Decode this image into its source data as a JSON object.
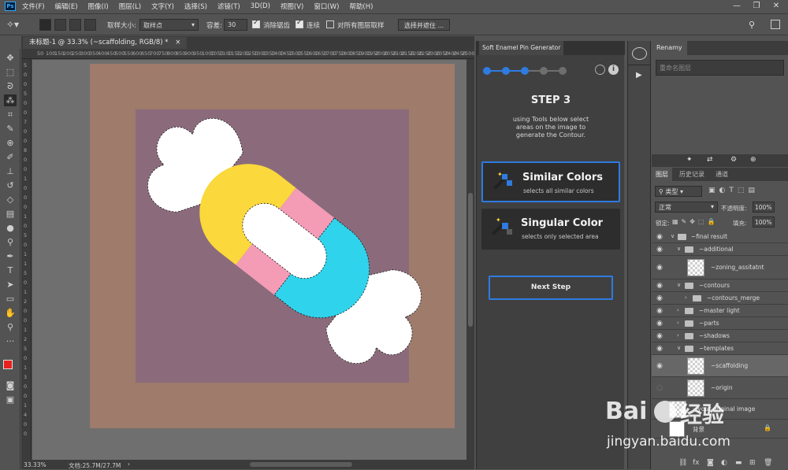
{
  "menubar": {
    "app_icon": "Ps",
    "items": [
      "文件(F)",
      "编辑(E)",
      "图像(I)",
      "图层(L)",
      "文字(Y)",
      "选择(S)",
      "滤镜(T)",
      "3D(D)",
      "视图(V)",
      "窗口(W)",
      "帮助(H)"
    ]
  },
  "options_bar": {
    "sample_size_label": "取样大小:",
    "sample_size_value": "取样点",
    "tolerance_label": "容差:",
    "tolerance_value": "30",
    "antialias_label": "消除锯齿",
    "contiguous_label": "连续",
    "sample_all_label": "对所有图层取样",
    "select_mask_label": "选择并遮住 ..."
  },
  "document": {
    "tab_title": "未标题-1 @ 33.3% (~scaffolding, RGB/8) *",
    "ruler_top": [
      "50",
      "100",
      "150",
      "200",
      "250",
      "300",
      "350",
      "400",
      "450",
      "500",
      "550",
      "600",
      "650",
      "700",
      "750",
      "800",
      "850",
      "900",
      "950",
      "1000",
      "1050",
      "1100",
      "1150",
      "1200",
      "1250",
      "1300",
      "1350",
      "1400",
      "1450",
      "1500",
      "1550",
      "1600",
      "1650",
      "1700",
      "1750",
      "1800",
      "1850",
      "1900",
      "1950",
      "2000",
      "2050",
      "2100",
      "2150",
      "2200",
      "2250",
      "2300",
      "2350",
      "2400",
      "2450",
      "2500"
    ],
    "ruler_left": [
      "5",
      "0",
      "0",
      "5",
      "0",
      "0",
      "7",
      "0",
      "0",
      "8",
      "0",
      "0",
      "1",
      "0",
      "0",
      "0",
      "1",
      "0",
      "5",
      "0",
      "1",
      "1",
      "5",
      "0",
      "1",
      "2",
      "0",
      "0",
      "1",
      "2",
      "5",
      "0",
      "1",
      "3",
      "0",
      "0",
      "1",
      "4",
      "0",
      "0"
    ],
    "zoom": "33.33%",
    "doc_info": "文档:25.7M/27.7M"
  },
  "plugin": {
    "tab_title": "Soft Enamel Pin Generator",
    "step_title": "STEP 3",
    "step_desc_lines": [
      "using Tools below select",
      "areas on the image to",
      "generate the Contour."
    ],
    "options": [
      {
        "title": "Similar Colors",
        "subtitle": "selects all similar colors"
      },
      {
        "title": "Singular Color",
        "subtitle": "selects only selected area"
      }
    ],
    "next_label": "Next Step",
    "colors": {
      "accent": "#2f7be0",
      "dot_active": "#2f7be0",
      "dot_inactive": "#6e6e6e"
    }
  },
  "renamy": {
    "tab_title": "Renamy",
    "search_placeholder": "重命名图层"
  },
  "layers_panel": {
    "tabs": [
      "图层",
      "历史记录",
      "通道"
    ],
    "kind_label": "类型",
    "blend_mode": "正常",
    "opacity_label": "不透明度:",
    "opacity_value": "100%",
    "lock_label": "锁定:",
    "fill_label": "填充:",
    "fill_value": "100%",
    "rows": [
      {
        "name": "~final result",
        "indent": 0,
        "type": "group"
      },
      {
        "name": "~additional",
        "indent": 1,
        "type": "group"
      },
      {
        "name": "~zoning_assitatnt",
        "indent": 2,
        "type": "layer"
      },
      {
        "name": "~contours",
        "indent": 1,
        "type": "group"
      },
      {
        "name": "~contours_merge",
        "indent": 2,
        "type": "group"
      },
      {
        "name": "~master light",
        "indent": 1,
        "type": "group"
      },
      {
        "name": "~parts",
        "indent": 1,
        "type": "group"
      },
      {
        "name": "~shadows",
        "indent": 1,
        "type": "group"
      },
      {
        "name": "~templates",
        "indent": 1,
        "type": "group"
      },
      {
        "name": "~scaffolding",
        "indent": 2,
        "type": "layer"
      },
      {
        "name": "~origin",
        "indent": 2,
        "type": "layer"
      },
      {
        "name": "~your original image",
        "indent": 1,
        "type": "layer"
      },
      {
        "name": "背景",
        "indent": 0,
        "type": "layer"
      }
    ]
  },
  "watermark": {
    "brand": "Bai",
    "brand2": "经验",
    "url": "jingyan.baidu.com"
  },
  "colors": {
    "foreground": "#e8221e",
    "background": "#ffffff",
    "canvas_outer": "#9e7b6b",
    "canvas_inner": "#8b6b7b",
    "candy_yellow": "#fbd83b",
    "candy_pink": "#f49bb6",
    "candy_cyan": "#2fd3ec"
  }
}
